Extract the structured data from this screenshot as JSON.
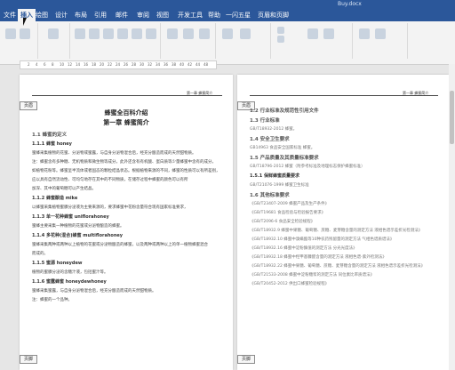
{
  "window": {
    "title": "Buy.docx"
  },
  "ribbon_tabs": [
    "文件",
    "插入",
    "绘图",
    "设计",
    "布局",
    "引用",
    "邮件",
    "审阅",
    "视图",
    "开发工具",
    "帮助",
    "一闪五星",
    "页眉和页脚"
  ],
  "active_tab": "插入",
  "ruler_numbers": [
    "2",
    "4",
    "6",
    "8",
    "10",
    "12",
    "14",
    "16",
    "18",
    "20",
    "22",
    "24",
    "26",
    "28",
    "30",
    "32",
    "34",
    "36",
    "38",
    "40",
    "42",
    "44",
    "48"
  ],
  "left_page": {
    "header_right": "第一章 蜂蜜简介",
    "header_label": "页眉",
    "footer_label": "页脚",
    "title": "蜂蜜全百科介绍",
    "subtitle": "第一章 蜂蜜简介",
    "lines": [
      {
        "style": "h1",
        "text": "1.1 蜂蜜的定义"
      },
      {
        "style": "h2",
        "text": "1.1.1 蜂蜜 honey"
      },
      {
        "style": "body",
        "text": "蜜蜂采集植物的花蜜、分泌物或蜜露，与自身分泌物混合后，经充分酿造而成的天然甜物质。"
      },
      {
        "style": "body",
        "text": "注：蜂蜜含有多种糖、无机物质和微生物等成分，此外还含有有机酸、蛋白质等少量蜂蜜中含有的成分，"
      },
      {
        "style": "body",
        "text": "如植物花粉等。蜂蜜呈半流体或者固态的颗粒结晶状态。根据植物来源的不同，蜂蜜的性质可以有所差别，"
      },
      {
        "style": "body",
        "text": "应以具有自然流动性、可均匀地存在其中的不同物质，在储存过程中蜂蜜的颜色可以有所"
      },
      {
        "style": "body",
        "text": "加深、其中的葡萄糖可以产生结晶。"
      },
      {
        "style": "h2",
        "text": "1.1.2 蜂蜜酿造 mike"
      },
      {
        "style": "body",
        "text": "以蜂蜜采集植物蜜腺分泌液为主要来源的，要求蜂蜜中花粉含量符合现有国家标准要求，"
      },
      {
        "style": "h2",
        "text": "1.1.3 单一花种蜂蜜 uniflorahoney"
      },
      {
        "style": "body",
        "text": "蜜蜂主要采集一种植物的花蜜或分泌物酿造的蜂蜜。"
      },
      {
        "style": "h2",
        "text": "1.1.4 多花种(混合)蜂蜜 multiflorahoney"
      },
      {
        "style": "body",
        "text": "蜜蜂采集两种或两种以上植物的花蜜或分泌物酿造的蜂蜜，以及两种或两种以上的单一植物蜂蜜混合"
      },
      {
        "style": "body",
        "text": "而成的。"
      },
      {
        "style": "h2",
        "text": "1.1.5 蜜源 honeydew"
      },
      {
        "style": "body",
        "text": "植物的蜜腺分泌的含糖汁液，包括蜜汁等。"
      },
      {
        "style": "h2",
        "text": "1.1.6 蜜露蜂蜜 honeydewhoney"
      },
      {
        "style": "body",
        "text": "蜜蜂采集蜜露，与自身分泌物混合后，经充分酿造而成的天然甜物质。"
      },
      {
        "style": "body",
        "text": "注：蜂蜜的一个品种。"
      }
    ]
  },
  "right_page": {
    "header_right": "第一章 蜂蜜简介",
    "header_label": "页眉",
    "footer_label": "页脚",
    "lines": [
      {
        "style": "h1",
        "text": "1.2 行业标准及规范性引用文件"
      },
      {
        "style": "h1",
        "text": "1.3 行业标准"
      },
      {
        "style": "ref",
        "text": "GB/T18932-2012 蜂蜜。"
      },
      {
        "style": "h1",
        "text": "1.4 安全卫生要求"
      },
      {
        "style": "ref",
        "text": "GB14963 食品安全国家标准 蜂蜜。"
      },
      {
        "style": "h1",
        "text": "1.5 产品质量及其质量标准要求"
      },
      {
        "style": "ref",
        "text": "GB/T18796-2012 蜂蜜（附参考标准及地理标志保护蜂蜜标准）"
      },
      {
        "style": "h2",
        "text": "1.5.1 保鲜蜂蜜质量要求"
      },
      {
        "style": "ref",
        "text": "GB/T21076-1999 蜂蜜卫生标准"
      },
      {
        "style": "h1",
        "text": "1.6 其他标准要求"
      },
      {
        "style": "ref",
        "text": "《GB/T23407-2009 蜂蜜产品及生产条件》"
      },
      {
        "style": "ref",
        "text": "《GB/T19681 食品检验与检验报告要求》"
      },
      {
        "style": "ref",
        "text": "《GB/T2096-6 食品安全检验规程》"
      },
      {
        "style": "ref",
        "text": "《GB/T18932.9 蜂蜜中果糖、葡萄糖、蔗糖、麦芽糖含量的测定方法 液相色谱示差折光检测法》"
      },
      {
        "style": "ref",
        "text": "《GB/T18932.10 蜂蜜中溴螨酯等10种农药残留量的测定方法 气相色谱质谱法》"
      },
      {
        "style": "ref",
        "text": "《GB/T18932.16 蜂蜜中淀粉酶值的测定方法 分光光度法》"
      },
      {
        "style": "ref",
        "text": "《GB/T18932.18 蜂蜜中羟甲基糠醛含量的测定方法 液相色谱-紫外检测法》"
      },
      {
        "style": "ref",
        "text": "《GB/T18932.22 蜂蜜中果糖、葡萄糖、蔗糖、麦芽糖含量的测定方法 液相色谱示差折光检测法》"
      },
      {
        "style": "ref",
        "text": "《GB/T21533-2008 蜂蜜中淀粉糖浆的测定方法 同位素比率质谱法》"
      },
      {
        "style": "ref",
        "text": "《GB/T20452-2012 供出口蜂蜜检验规程》"
      }
    ]
  }
}
